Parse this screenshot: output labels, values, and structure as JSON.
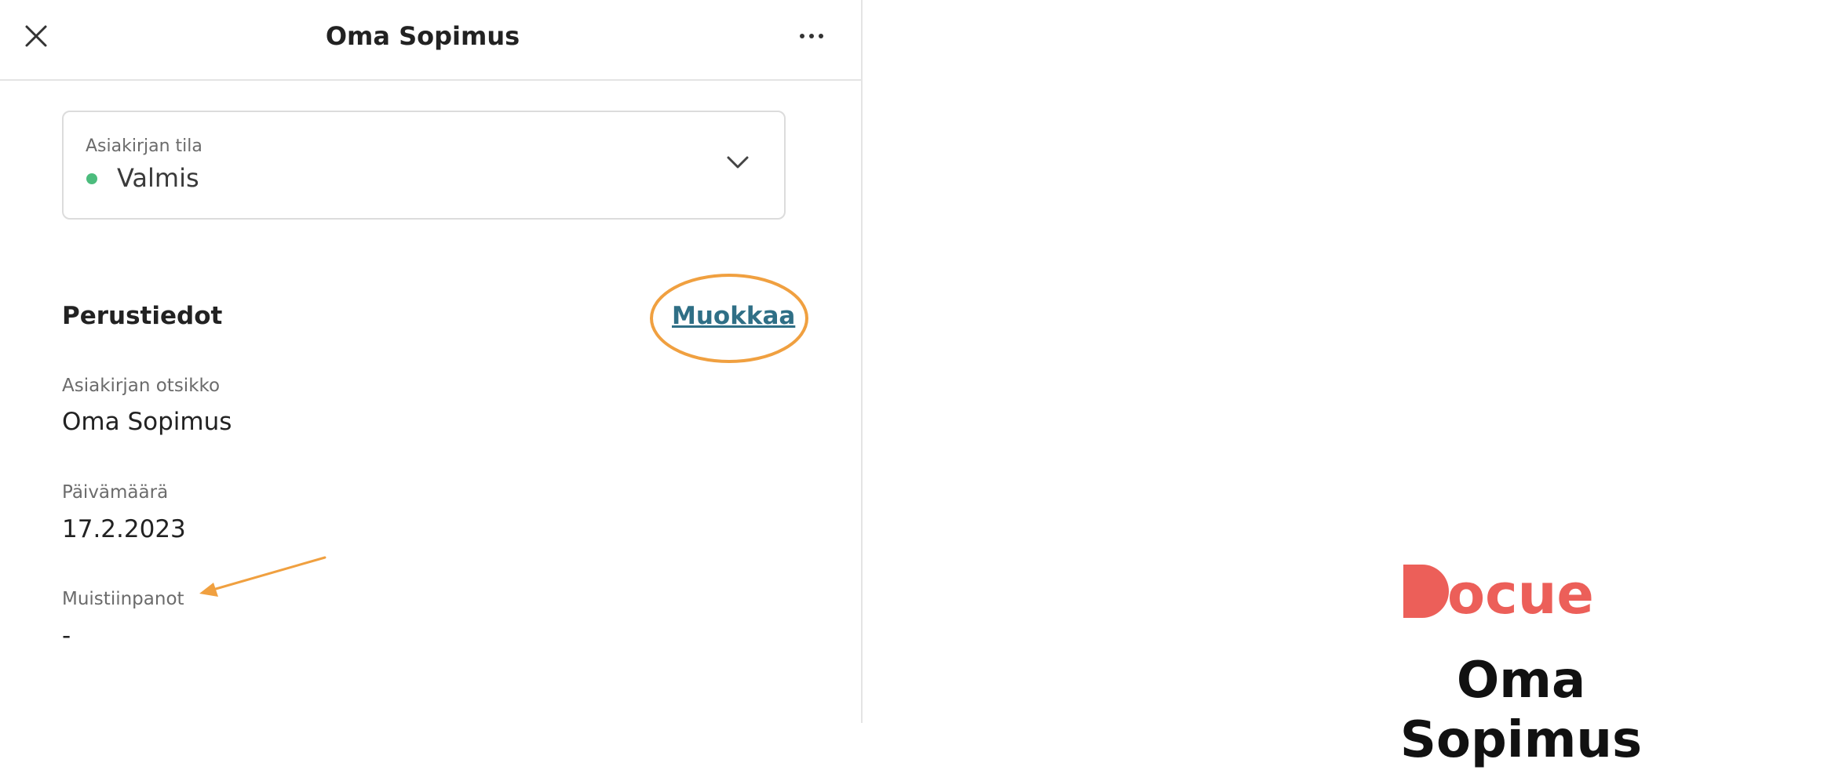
{
  "header": {
    "title": "Oma Sopimus",
    "close_icon": "close-icon",
    "more_icon": "more-horizontal-icon"
  },
  "status": {
    "label": "Asiakirjan tila",
    "value": "Valmis",
    "dot_color": "#4cbc7d",
    "chevron_icon": "chevron-down-icon"
  },
  "basic_info": {
    "title": "Perustiedot",
    "edit_label": "Muokkaa",
    "fields": [
      {
        "label": "Asiakirjan otsikko",
        "value": "Oma Sopimus"
      },
      {
        "label": "Päivämäärä",
        "value": "17.2.2023"
      },
      {
        "label": "Muistiinpanot",
        "value": "-"
      }
    ]
  },
  "annotations": {
    "highlight_color": "#f0a040"
  },
  "preview": {
    "logo_text": "Docue",
    "logo_color": "#ec5f59",
    "document_title": "Oma Sopimus"
  }
}
